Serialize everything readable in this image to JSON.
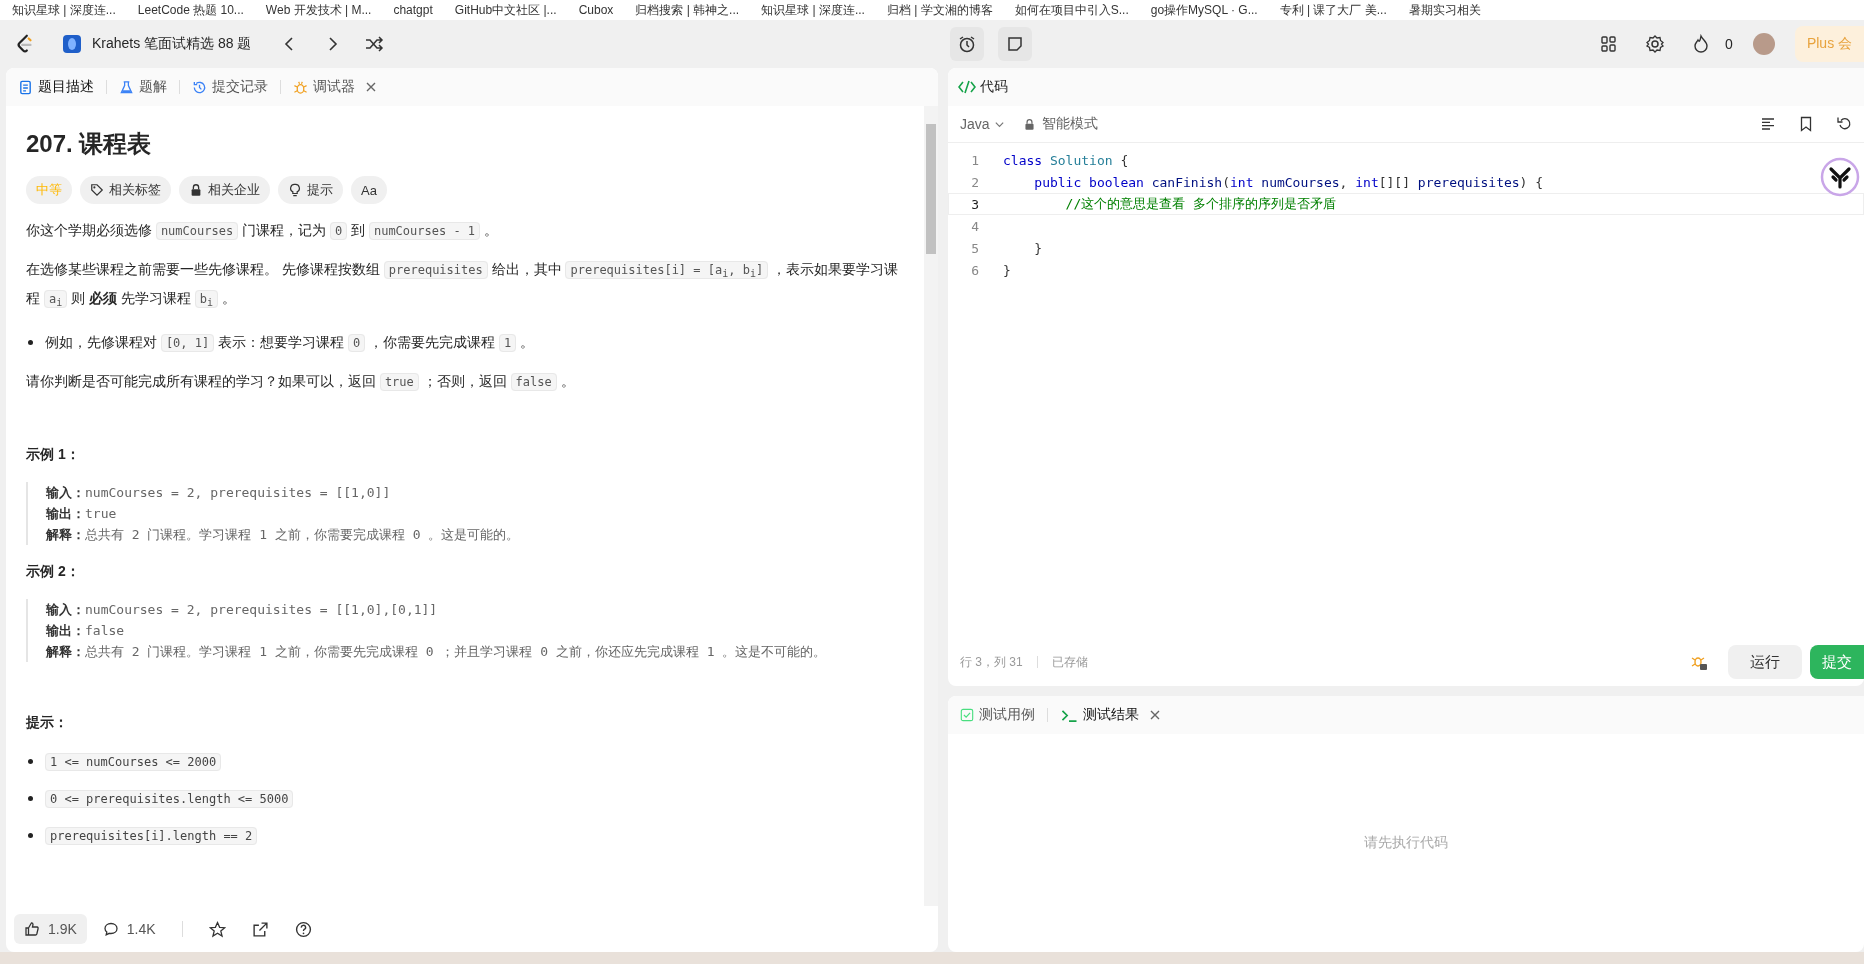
{
  "bookmarks": [
    "知识星球 | 深度连...",
    "LeetCode 热题 10...",
    "Web 开发技术 | M...",
    "chatgpt",
    "GitHub中文社区 |...",
    "Cubox",
    "归档搜索 | 韩神之...",
    "知识星球 | 深度连...",
    "归档 | 学文湘的博客",
    "如何在项目中引入S...",
    "go操作MySQL · G...",
    "专利 | 课了大厂 美...",
    "暑期实习相关"
  ],
  "nav": {
    "problem_set": "Krahets 笔面试精选 88 题",
    "streak": "0",
    "plus": "Plus 会"
  },
  "left_tabs": [
    {
      "label": "题目描述",
      "kind": "doc",
      "selected": true,
      "closable": false
    },
    {
      "label": "题解",
      "kind": "flask",
      "selected": false,
      "closable": false
    },
    {
      "label": "提交记录",
      "kind": "history",
      "selected": false,
      "closable": false
    },
    {
      "label": "调试器",
      "kind": "bug",
      "selected": false,
      "closable": true
    }
  ],
  "problem": {
    "title": "207. 课程表",
    "tags": [
      {
        "label": "中等",
        "kind": "difficulty"
      },
      {
        "label": "相关标签",
        "kind": "tag"
      },
      {
        "label": "相关企业",
        "kind": "lock"
      },
      {
        "label": "提示",
        "kind": "bulb"
      },
      {
        "label": "Aa",
        "kind": "translate"
      }
    ],
    "paragraphs": [
      {
        "kind": "plain",
        "parts": [
          {
            "kind": "text",
            "t": "你这个学期必须选修 "
          },
          {
            "kind": "code",
            "t": "numCourses"
          },
          {
            "kind": "text",
            "t": " 门课程，记为 "
          },
          {
            "kind": "code",
            "t": "0"
          },
          {
            "kind": "text",
            "t": " 到 "
          },
          {
            "kind": "code",
            "t": "numCourses - 1"
          },
          {
            "kind": "text",
            "t": " 。"
          }
        ]
      },
      {
        "kind": "plain",
        "parts": [
          {
            "kind": "text",
            "t": "在选修某些课程之前需要一些先修课程。 先修课程按数组 "
          },
          {
            "kind": "code",
            "t": "prerequisites"
          },
          {
            "kind": "text",
            "t": " 给出，其中 "
          },
          {
            "kind": "code",
            "t": "prerequisites[i] = [a$_{i}$, b$_{i}$]"
          },
          {
            "kind": "text",
            "t": " ，表示如果要学习课程 "
          },
          {
            "kind": "code",
            "t": "a$_{i}$"
          },
          {
            "kind": "text",
            "t": " 则 "
          },
          {
            "kind": "bold",
            "t": "必须"
          },
          {
            "kind": "text",
            "t": " 先学习课程  "
          },
          {
            "kind": "code",
            "t": "b$_{i}$"
          },
          {
            "kind": "text",
            "t": " 。"
          }
        ]
      },
      {
        "kind": "bullet",
        "parts": [
          {
            "kind": "text",
            "t": "例如，先修课程对 "
          },
          {
            "kind": "code",
            "t": "[0, 1]"
          },
          {
            "kind": "text",
            "t": " 表示：想要学习课程 "
          },
          {
            "kind": "code",
            "t": "0"
          },
          {
            "kind": "text",
            "t": " ，你需要先完成课程 "
          },
          {
            "kind": "code",
            "t": "1"
          },
          {
            "kind": "text",
            "t": " 。"
          }
        ]
      },
      {
        "kind": "plain",
        "parts": [
          {
            "kind": "text",
            "t": "请你判断是否可能完成所有课程的学习？如果可以，返回 "
          },
          {
            "kind": "code",
            "t": "true"
          },
          {
            "kind": "text",
            "t": " ；否则，返回 "
          },
          {
            "kind": "code",
            "t": "false"
          },
          {
            "kind": "text",
            "t": " 。"
          }
        ]
      }
    ],
    "examples": [
      {
        "title": "示例 1：",
        "lines": [
          {
            "label": "输入：",
            "value": "numCourses = 2, prerequisites = [[1,0]]"
          },
          {
            "label": "输出：",
            "value": "true"
          },
          {
            "label": "解释：",
            "value": "总共有 2 门课程。学习课程 1 之前，你需要完成课程 0 。这是可能的。"
          }
        ]
      },
      {
        "title": "示例 2：",
        "lines": [
          {
            "label": "输入：",
            "value": "numCourses = 2, prerequisites = [[1,0],[0,1]]"
          },
          {
            "label": "输出：",
            "value": "false"
          },
          {
            "label": "解释：",
            "value": "总共有 2 门课程。学习课程 1 之前，你需要先完成课程 0 ；并且学习课程 0 之前，你还应先完成课程 1 。这是不可能的。"
          }
        ]
      }
    ],
    "hints_title": "提示：",
    "constraints": [
      "1 <= numCourses <= 2000",
      "0 <= prerequisites.length <= 5000",
      "prerequisites[i].length == 2"
    ]
  },
  "footer": {
    "likes": "1.9K",
    "comments": "1.4K"
  },
  "code": {
    "title": "代码",
    "language": "Java",
    "mode": "智能模式",
    "lines": [
      {
        "num": "1",
        "current": false,
        "tokens": [
          {
            "kind": "kw",
            "t": "class "
          },
          {
            "kind": "type",
            "t": "Solution"
          },
          {
            "kind": "plain",
            "t": " {"
          }
        ]
      },
      {
        "num": "2",
        "current": false,
        "tokens": [
          {
            "kind": "kw",
            "t": "    public boolean "
          },
          {
            "kind": "fn",
            "t": "canFinish"
          },
          {
            "kind": "plain",
            "t": "("
          },
          {
            "kind": "kw",
            "t": "int"
          },
          {
            "kind": "fn",
            "t": " numCourses"
          },
          {
            "kind": "plain",
            "t": ", "
          },
          {
            "kind": "kw",
            "t": "int"
          },
          {
            "kind": "plain",
            "t": "[][] "
          },
          {
            "kind": "fn",
            "t": "prerequisites"
          },
          {
            "kind": "plain",
            "t": ") {"
          }
        ]
      },
      {
        "num": "3",
        "current": true,
        "tokens": [
          {
            "kind": "comment",
            "t": "        //这个的意思是查看 多个排序的序列是否矛盾"
          }
        ]
      },
      {
        "num": "4",
        "current": false
      },
      {
        "num": "5",
        "current": false,
        "tokens": [
          {
            "kind": "plain",
            "t": "    }"
          }
        ]
      },
      {
        "num": "6",
        "current": false,
        "tokens": [
          {
            "kind": "plain",
            "t": "}"
          }
        ]
      }
    ],
    "position": "行 3，列 31",
    "saved": "已存储",
    "run": "运行",
    "submit": "提交"
  },
  "result_tabs": [
    {
      "label": "测试用例",
      "kind": "check",
      "selected": false,
      "closable": false
    },
    {
      "label": "测试结果",
      "kind": "terminal",
      "selected": true,
      "closable": true
    }
  ],
  "result_empty": "请先执行代码"
}
